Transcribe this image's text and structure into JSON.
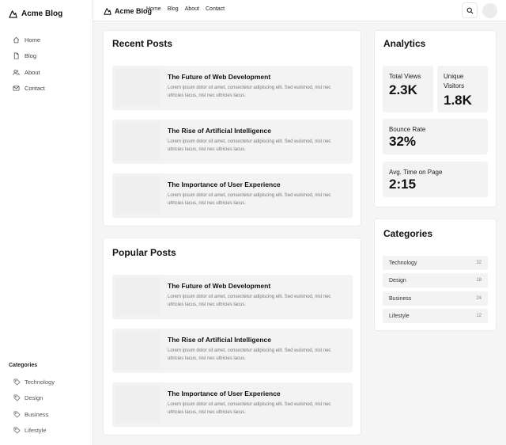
{
  "app": {
    "brand": "Acme Blog"
  },
  "sidebar": {
    "nav": [
      {
        "label": "Home",
        "icon": "home-icon"
      },
      {
        "label": "Blog",
        "icon": "document-icon"
      },
      {
        "label": "About",
        "icon": "users-icon"
      },
      {
        "label": "Contact",
        "icon": "mail-icon"
      }
    ],
    "categories_heading": "Categories",
    "categories": [
      {
        "label": "Technology",
        "icon": "tag-icon"
      },
      {
        "label": "Design",
        "icon": "tag-icon"
      },
      {
        "label": "Business",
        "icon": "tag-icon"
      },
      {
        "label": "Lifestyle",
        "icon": "tag-icon"
      }
    ]
  },
  "topbar": {
    "brand": "Acme Blog",
    "nav": [
      "Home",
      "Blog",
      "About",
      "Contact"
    ],
    "search_icon": "search-icon"
  },
  "recent_posts": {
    "title": "Recent Posts",
    "posts": [
      {
        "title": "The Future of Web Development",
        "excerpt": "Lorem ipsum dolor sit amet, consectetur adipiscing elit. Sed euismod, nisl nec ultricies lacus, nisl nec ultricies lacus."
      },
      {
        "title": "The Rise of Artificial Intelligence",
        "excerpt": "Lorem ipsum dolor sit amet, consectetur adipiscing elit. Sed euismod, nisl nec ultricies lacus, nisl nec ultricies lacus."
      },
      {
        "title": "The Importance of User Experience",
        "excerpt": "Lorem ipsum dolor sit amet, consectetur adipiscing elit. Sed euismod, nisl nec ultricies lacus, nisl nec ultricies lacus."
      }
    ]
  },
  "popular_posts": {
    "title": "Popular Posts",
    "posts": [
      {
        "title": "The Future of Web Development",
        "excerpt": "Lorem ipsum dolor sit amet, consectetur adipiscing elit. Sed euismod, nisl nec ultricies lacus, nisl nec ultricies lacus."
      },
      {
        "title": "The Rise of Artificial Intelligence",
        "excerpt": "Lorem ipsum dolor sit amet, consectetur adipiscing elit. Sed euismod, nisl nec ultricies lacus, nisl nec ultricies lacus."
      },
      {
        "title": "The Importance of User Experience",
        "excerpt": "Lorem ipsum dolor sit amet, consectetur adipiscing elit. Sed euismod, nisl nec ultricies lacus, nisl nec ultricies lacus."
      }
    ]
  },
  "analytics": {
    "title": "Analytics",
    "total_views": {
      "label": "Total Views",
      "value": "2.3K"
    },
    "unique_visitors": {
      "label": "Unique Visitors",
      "value": "1.8K"
    },
    "bounce_rate": {
      "label": "Bounce Rate",
      "value": "32%"
    },
    "avg_time": {
      "label": "Avg. Time on Page",
      "value": "2:15"
    }
  },
  "categories_card": {
    "title": "Categories",
    "items": [
      {
        "name": "Technology",
        "count": "32"
      },
      {
        "name": "Design",
        "count": "18"
      },
      {
        "name": "Business",
        "count": "24"
      },
      {
        "name": "Lifestyle",
        "count": "12"
      }
    ]
  }
}
